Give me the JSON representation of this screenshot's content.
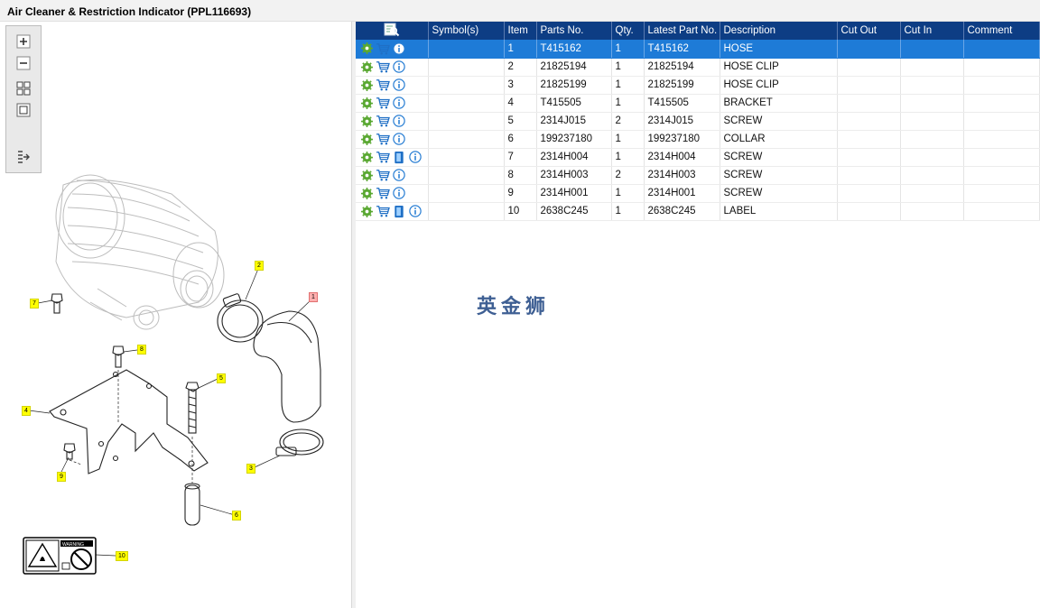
{
  "window": {
    "title_hint": "",
    "title": "Air Cleaner & Restriction Indicator (PPL116693)"
  },
  "viewer": {
    "toolbar": [
      {
        "name": "zoom-in-icon"
      },
      {
        "name": "zoom-out-icon"
      },
      {
        "name": "fit-page-icon"
      },
      {
        "name": "actual-size-icon"
      },
      {
        "name": "list-export-icon"
      }
    ],
    "callouts": [
      {
        "label": "1",
        "style": "red"
      },
      {
        "label": "2"
      },
      {
        "label": "3"
      },
      {
        "label": "4"
      },
      {
        "label": "5"
      },
      {
        "label": "6"
      },
      {
        "label": "7"
      },
      {
        "label": "8"
      },
      {
        "label": "9"
      },
      {
        "label": "10"
      }
    ],
    "warning_label_text": "WARNING"
  },
  "table": {
    "columns": [
      {
        "key": "actions",
        "label": "",
        "icon": "search-parts-icon"
      },
      {
        "key": "symbols",
        "label": "Symbol(s)"
      },
      {
        "key": "item",
        "label": "Item"
      },
      {
        "key": "parts_no",
        "label": "Parts No."
      },
      {
        "key": "qty",
        "label": "Qty."
      },
      {
        "key": "latest",
        "label": "Latest Part No."
      },
      {
        "key": "desc",
        "label": "Description"
      },
      {
        "key": "cut_out",
        "label": "Cut Out"
      },
      {
        "key": "cut_in",
        "label": "Cut In"
      },
      {
        "key": "comment",
        "label": "Comment"
      }
    ],
    "rows": [
      {
        "item": "1",
        "parts_no": "T415162",
        "qty": "1",
        "latest": "T415162",
        "desc": "HOSE",
        "selected": true,
        "has_doc": false
      },
      {
        "item": "2",
        "parts_no": "21825194",
        "qty": "1",
        "latest": "21825194",
        "desc": "HOSE CLIP",
        "has_doc": false
      },
      {
        "item": "3",
        "parts_no": "21825199",
        "qty": "1",
        "latest": "21825199",
        "desc": "HOSE CLIP",
        "has_doc": false
      },
      {
        "item": "4",
        "parts_no": "T415505",
        "qty": "1",
        "latest": "T415505",
        "desc": "BRACKET",
        "has_doc": false
      },
      {
        "item": "5",
        "parts_no": "2314J015",
        "qty": "2",
        "latest": "2314J015",
        "desc": "SCREW",
        "has_doc": false
      },
      {
        "item": "6",
        "parts_no": "199237180",
        "qty": "1",
        "latest": "199237180",
        "desc": "COLLAR",
        "has_doc": false
      },
      {
        "item": "7",
        "parts_no": "2314H004",
        "qty": "1",
        "latest": "2314H004",
        "desc": "SCREW",
        "has_doc": true
      },
      {
        "item": "8",
        "parts_no": "2314H003",
        "qty": "2",
        "latest": "2314H003",
        "desc": "SCREW",
        "has_doc": false
      },
      {
        "item": "9",
        "parts_no": "2314H001",
        "qty": "1",
        "latest": "2314H001",
        "desc": "SCREW",
        "has_doc": false
      },
      {
        "item": "10",
        "parts_no": "2638C245",
        "qty": "1",
        "latest": "2638C245",
        "desc": "LABEL",
        "has_doc": true
      }
    ],
    "row_icons": [
      "gear-icon",
      "cart-icon",
      "document-icon",
      "info-icon"
    ]
  },
  "watermark": "英金狮",
  "colors": {
    "header_bg": "#0d3d84",
    "selected_row": "#1e7bd7",
    "callout_yellow": "#ffff00",
    "callout_red": "#ffb0b0",
    "watermark": "#2a4e88"
  }
}
